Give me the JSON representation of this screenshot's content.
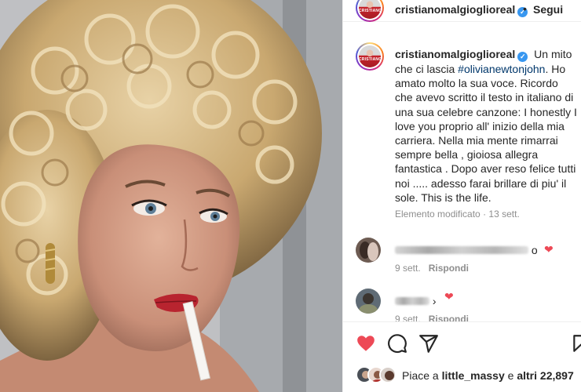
{
  "post": {
    "username": "cristianomalgioglioreal",
    "follow_separator": "•",
    "follow_label": "Segui",
    "avatar_label": "CRISTIANO",
    "caption_username": "cristianomalgioglioreal",
    "caption_before": "Un mito che ci lascia ",
    "caption_hashtag": "#olivianewtonjohn",
    "caption_after": ". Ho amato molto la sua voce. Ricordo che avevo scritto il testo in italiano di una sua celebre canzone: I honestly I love you proprio all' inizio della mia carriera. Nella mia mente rimarrai sempre bella , gioiosa allegra fantastica . Dopo aver reso felice tutti noi ..... adesso farai brillare di piu' il sole. This is the life.",
    "edited_label": "Elemento modificato",
    "meta_dot": "·",
    "time": "13 sett."
  },
  "comments": [
    {
      "suffix": "o",
      "time": "9 sett.",
      "reply_label": "Rispondi"
    },
    {
      "suffix": "›",
      "time": "9 sett.",
      "reply_label": "Rispondi"
    }
  ],
  "likes": {
    "prefix": "Piace a ",
    "user": "little_massy",
    "middle": " e ",
    "others": "altri 22,897"
  },
  "icons": [
    "verified-badge",
    "heart-icon",
    "comment-icon",
    "share-icon",
    "bookmark-icon"
  ],
  "colors": {
    "heart": "#ed4956",
    "verified": "#3897f0",
    "hashtag": "#00376b",
    "muted": "#8e8e8e"
  }
}
